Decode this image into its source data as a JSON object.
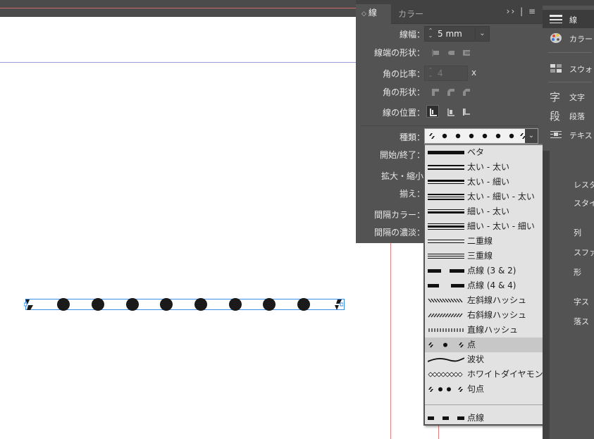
{
  "panel": {
    "tabs": {
      "active": "線",
      "inactive": "カラー"
    },
    "menu_glyph": "›› | ≡",
    "weight": {
      "label": "線幅：",
      "value": "5 mm"
    },
    "cap_label": "線端の形状：",
    "miter": {
      "label": "角の比率：",
      "value": "4",
      "suffix": "x"
    },
    "join_label": "角の形状：",
    "align_label": "線の位置：",
    "type_label": "種類：",
    "start_end_label": "開始/終了：",
    "scale_label": "拡大・縮小",
    "align2_label": "揃え：",
    "gap_color_label": "間隔カラー：",
    "gap_tint_label": "間隔の濃淡："
  },
  "dropdown": {
    "items": [
      {
        "label": "ベタ",
        "sample": "solid"
      },
      {
        "label": "太い - 太い",
        "sample": "thick-thick"
      },
      {
        "label": "太い - 細い",
        "sample": "thick-thin"
      },
      {
        "label": "太い - 細い - 太い",
        "sample": "thick-thin-thick"
      },
      {
        "label": "細い - 太い",
        "sample": "thin-thick"
      },
      {
        "label": "細い - 太い - 細い",
        "sample": "thin-thick-thin"
      },
      {
        "label": "二重線",
        "sample": "double"
      },
      {
        "label": "三重線",
        "sample": "triple"
      },
      {
        "label": "点線 (3 & 2)",
        "sample": "dash32"
      },
      {
        "label": "点線 (4 & 4)",
        "sample": "dash44"
      },
      {
        "label": "左斜線ハッシュ",
        "sample": "left-hash"
      },
      {
        "label": "右斜線ハッシュ",
        "sample": "right-hash"
      },
      {
        "label": "直線ハッシュ",
        "sample": "straight-hash"
      },
      {
        "label": "点",
        "sample": "dots",
        "selected": true
      },
      {
        "label": "波状",
        "sample": "wavy"
      },
      {
        "label": "ホワイトダイヤモンド",
        "sample": "white-diamond"
      },
      {
        "label": "句点",
        "sample": "japanese-dots"
      }
    ],
    "custom_items": [
      {
        "label": "点線",
        "sample": "dashed"
      }
    ]
  },
  "dock": {
    "items": [
      {
        "label": "線",
        "icon": "stroke-lines-icon",
        "active": true
      },
      {
        "label": "カラー",
        "icon": "palette-icon"
      },
      {
        "label": "スウォッチ",
        "icon": "swatches-icon"
      },
      {
        "label": "文字",
        "icon": "character-icon",
        "glyph": "字"
      },
      {
        "label": "段落",
        "icon": "paragraph-icon",
        "glyph": "段"
      },
      {
        "label": "テキスト",
        "icon": "text-wrap-icon"
      }
    ],
    "stubs": [
      "レスタ",
      "スタイ",
      "列",
      "スファ",
      "形",
      "字ス",
      "落ス"
    ]
  },
  "colors": {
    "panel_bg": "#535353",
    "dropdown_bg": "#e2e2e2",
    "highlight": "#c7c7c7",
    "selection_blue": "#3a8ee6"
  }
}
